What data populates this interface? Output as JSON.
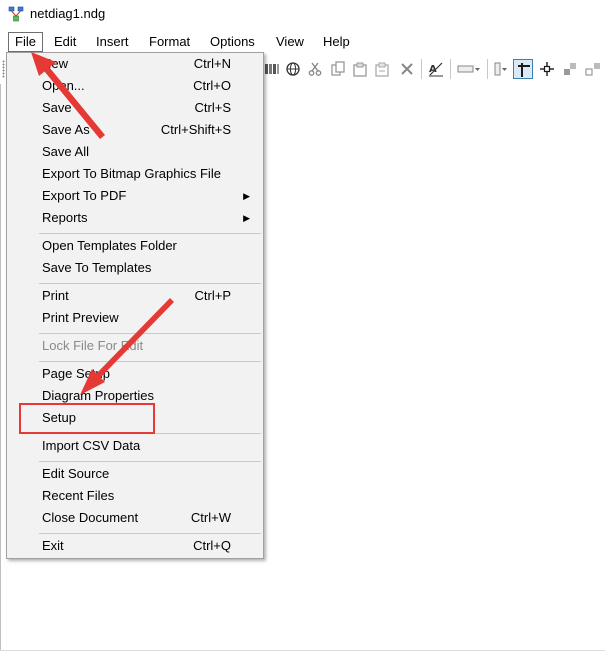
{
  "window": {
    "title": "netdiag1.ndg",
    "icon": "network-diagram-app-icon"
  },
  "menubar": {
    "items": [
      {
        "label": "File",
        "active": true
      },
      {
        "label": "Edit"
      },
      {
        "label": "Insert"
      },
      {
        "label": "Format"
      },
      {
        "label": "Options"
      },
      {
        "label": "View"
      },
      {
        "label": "Help"
      }
    ]
  },
  "toolbar": {
    "icons": [
      "library-icon",
      "globe-icon",
      "cut-icon",
      "copy-icon",
      "paste-icon",
      "paste-special-icon",
      "delete-icon",
      "text-format-icon",
      "line-style-icon",
      "shape-style-icon",
      "pointer-tool-icon",
      "node-tool-icon",
      "group-icon",
      "ungroup-icon"
    ]
  },
  "file_menu": {
    "items": [
      {
        "label": "New",
        "shortcut": "Ctrl+N"
      },
      {
        "label": "Open...",
        "shortcut": "Ctrl+O"
      },
      {
        "label": "Save",
        "shortcut": "Ctrl+S"
      },
      {
        "label": "Save As",
        "shortcut": "Ctrl+Shift+S"
      },
      {
        "label": "Save All",
        "shortcut": ""
      },
      {
        "label": "Export To Bitmap Graphics File",
        "shortcut": ""
      },
      {
        "label": "Export To PDF",
        "shortcut": "",
        "submenu": true
      },
      {
        "label": "Reports",
        "shortcut": "",
        "submenu": true
      },
      {
        "label": "Open Templates Folder",
        "shortcut": ""
      },
      {
        "label": "Save To Templates",
        "shortcut": ""
      },
      {
        "label": "Print",
        "shortcut": "Ctrl+P"
      },
      {
        "label": "Print Preview",
        "shortcut": ""
      },
      {
        "label": "Lock File For Edit",
        "shortcut": "",
        "disabled": true
      },
      {
        "label": "Page Setup",
        "shortcut": ""
      },
      {
        "label": "Diagram Properties",
        "shortcut": ""
      },
      {
        "label": "Setup",
        "shortcut": "",
        "highlighted": true
      },
      {
        "label": "Import CSV Data",
        "shortcut": ""
      },
      {
        "label": "Edit Source",
        "shortcut": ""
      },
      {
        "label": "Recent Files",
        "shortcut": ""
      },
      {
        "label": "Close Document",
        "shortcut": "Ctrl+W"
      },
      {
        "label": "Exit",
        "shortcut": "Ctrl+Q"
      }
    ],
    "submenu_arrow": "▶"
  },
  "annotations": {
    "highlight_color": "#e53935",
    "arrow_color": "#e53935"
  }
}
